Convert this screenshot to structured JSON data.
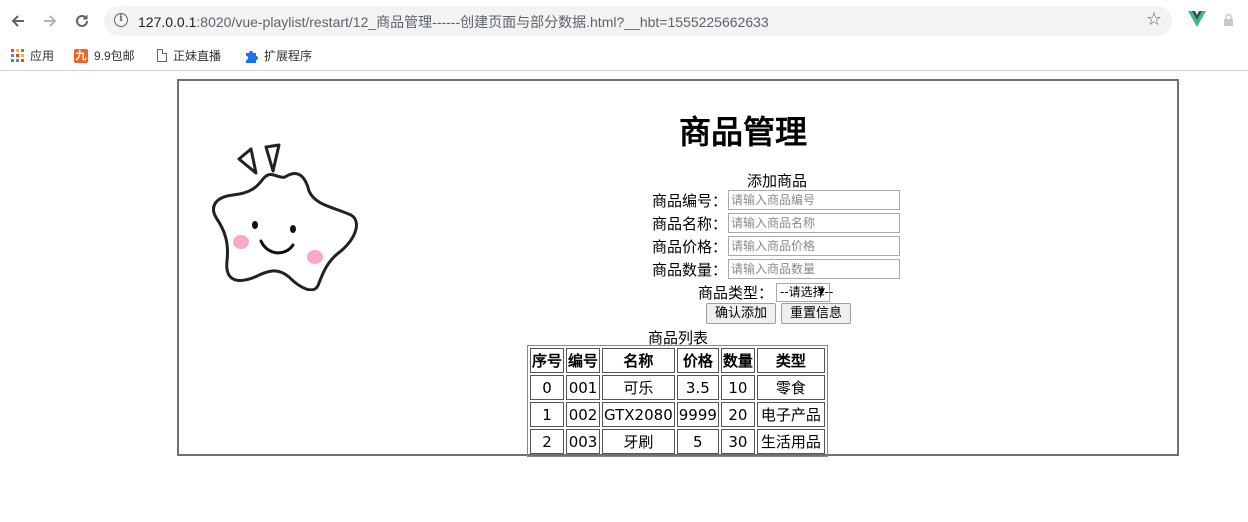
{
  "browser": {
    "url_host": "127.0.0.1",
    "url_path": ":8020/vue-playlist/restart/12_商品管理------创建页面与部分数据.html?__hbt=1555225662633"
  },
  "bookmarks": [
    {
      "label": "应用",
      "icon": "apps-grid-icon"
    },
    {
      "label": "9.9包邮",
      "icon": "nine-icon",
      "icon_text": "九"
    },
    {
      "label": "正妹直播",
      "icon": "page-icon"
    },
    {
      "label": "扩展程序",
      "icon": "puzzle-icon"
    }
  ],
  "page": {
    "title": "商品管理",
    "add_section": "添加商品",
    "fields": {
      "id": {
        "label": "商品编号：",
        "placeholder": "请输入商品编号"
      },
      "name": {
        "label": "商品名称：",
        "placeholder": "请输入商品名称"
      },
      "price": {
        "label": "商品价格：",
        "placeholder": "请输入商品价格"
      },
      "qty": {
        "label": "商品数量：",
        "placeholder": "请输入商品数量"
      }
    },
    "type_label": "商品类型：",
    "type_selected": "--请选择--",
    "confirm_button": "确认添加",
    "reset_button": "重置信息",
    "list_caption": "商品列表",
    "table": {
      "headers": [
        "序号",
        "编号",
        "名称",
        "价格",
        "数量",
        "类型"
      ],
      "rows": [
        [
          "0",
          "001",
          "可乐",
          "3.5",
          "10",
          "零食"
        ],
        [
          "1",
          "002",
          "GTX2080",
          "9999",
          "20",
          "电子产品"
        ],
        [
          "2",
          "003",
          "牙刷",
          "5",
          "30",
          "生活用品"
        ]
      ]
    }
  }
}
